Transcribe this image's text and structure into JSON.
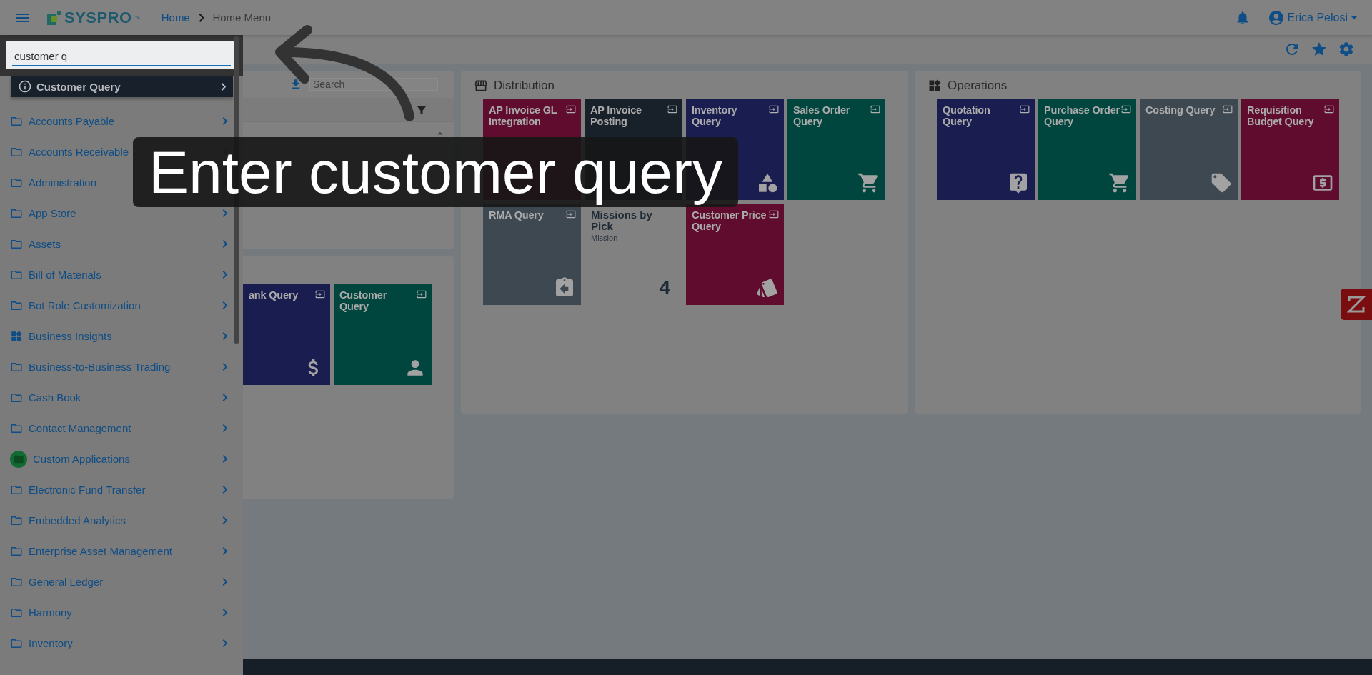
{
  "header": {
    "brand": "SYSPRO",
    "trademark": "™",
    "breadcrumb": [
      {
        "label": "Home",
        "current": false
      },
      {
        "label": "Home Menu",
        "current": true
      }
    ],
    "user": {
      "name": "Erica Pelosi"
    }
  },
  "menu_search": {
    "value": "customer q"
  },
  "search_results": [
    {
      "label": "Customer Query"
    }
  ],
  "sidebar": {
    "items": [
      {
        "label": "Accounts Payable",
        "kind": "folder"
      },
      {
        "label": "Accounts Receivable",
        "kind": "folder"
      },
      {
        "label": "Administration",
        "kind": "folder"
      },
      {
        "label": "App Store",
        "kind": "folder"
      },
      {
        "label": "Assets",
        "kind": "folder"
      },
      {
        "label": "Bill of Materials",
        "kind": "folder"
      },
      {
        "label": "Bot Role Customization",
        "kind": "folder"
      },
      {
        "label": "Business Insights",
        "kind": "insights"
      },
      {
        "label": "Business-to-Business Trading",
        "kind": "folder"
      },
      {
        "label": "Cash Book",
        "kind": "folder"
      },
      {
        "label": "Contact Management",
        "kind": "folder"
      },
      {
        "label": "Custom Applications",
        "kind": "custom"
      },
      {
        "label": "Electronic Fund Transfer",
        "kind": "folder"
      },
      {
        "label": "Embedded Analytics",
        "kind": "folder"
      },
      {
        "label": "Enterprise Asset Management",
        "kind": "folder"
      },
      {
        "label": "General Ledger",
        "kind": "folder"
      },
      {
        "label": "Harmony",
        "kind": "folder"
      },
      {
        "label": "Inventory",
        "kind": "folder"
      }
    ]
  },
  "list_panel": {
    "search": {
      "placeholder": "Search"
    }
  },
  "quick_panel": {
    "tiles": [
      {
        "kind": "program",
        "title": "ank Query",
        "color": "#1a1d4f"
      },
      {
        "kind": "program",
        "title": "Customer Query",
        "color": "#00463e"
      }
    ]
  },
  "panels": [
    {
      "title": "Distribution",
      "tiles": [
        {
          "kind": "program",
          "title": "AP Invoice GL Integration",
          "color": "#600c2e"
        },
        {
          "kind": "program",
          "title": "AP Invoice Posting",
          "color": "#18202a"
        },
        {
          "kind": "program",
          "title": "Inventory Query",
          "color": "#1a1d4f"
        },
        {
          "kind": "program",
          "title": "Sales Order Query",
          "color": "#00463e"
        },
        {
          "kind": "program",
          "title": "RMA Query",
          "color": "#3d4850"
        },
        {
          "kind": "kpi",
          "title": "Missions by Pick",
          "subtitle": "Mission",
          "value": "4"
        },
        {
          "kind": "program",
          "title": "Customer Price Query",
          "color": "#600c2e"
        }
      ]
    },
    {
      "title": "Operations",
      "tiles": [
        {
          "kind": "program",
          "title": "Quotation Query",
          "color": "#1a1d4f"
        },
        {
          "kind": "program",
          "title": "Purchase Order Query",
          "color": "#00463e"
        },
        {
          "kind": "program",
          "title": "Costing Query",
          "color": "#3d4850"
        },
        {
          "kind": "program",
          "title": "Requisition Budget Query",
          "color": "#600c2e"
        }
      ]
    }
  ],
  "caption": "Enter customer query"
}
